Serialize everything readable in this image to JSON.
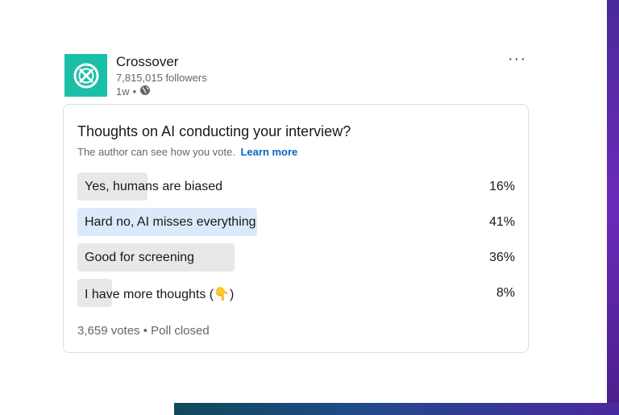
{
  "post": {
    "company": "Crossover",
    "followers": "7,815,015 followers",
    "time": "1w",
    "dot": "•",
    "more": "···",
    "logo_color": "#1bbfa7"
  },
  "poll": {
    "question": "Thoughts on AI conducting your interview?",
    "note": "The author can see how you vote.",
    "learn_more": "Learn more",
    "options": [
      {
        "label": "Yes, humans are biased",
        "percent": "16%",
        "fill_percent": 16,
        "selected": false
      },
      {
        "label": "Hard no, AI misses everything",
        "percent": "41%",
        "fill_percent": 41,
        "selected": true
      },
      {
        "label": "Good for screening",
        "percent": "36%",
        "fill_percent": 36,
        "selected": false
      },
      {
        "label": "I have more thoughts (👇)",
        "percent": "8%",
        "fill_percent": 8,
        "selected": false
      }
    ],
    "votes": "3,659 votes",
    "separator": "•",
    "status": "Poll closed",
    "accent_color": "#0a66c2",
    "selected_fill_color": "#dbe9fb",
    "fill_color": "#e8e8e8"
  },
  "icons": {
    "logo": "crossover-logo-icon",
    "visibility": "globe-icon",
    "menu": "more-options-icon"
  }
}
